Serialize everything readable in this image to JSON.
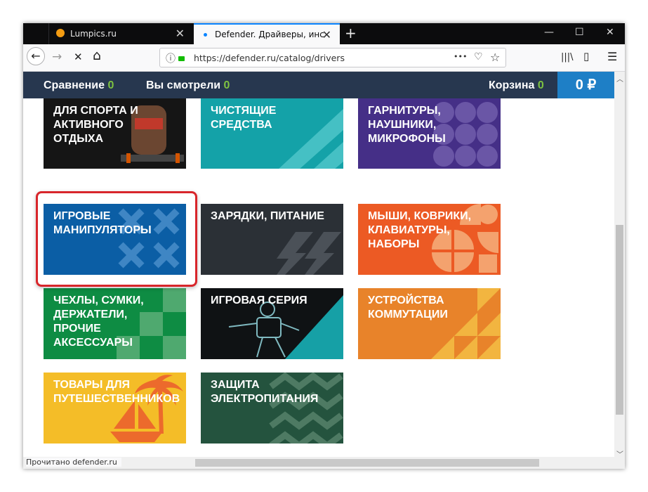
{
  "browser": {
    "tabs": [
      {
        "title": "Lumpics.ru",
        "close": "✕"
      },
      {
        "title": "Defender. Драйверы, инструкц",
        "close": "✕"
      }
    ],
    "new_tab": "+",
    "window_controls": {
      "minimize": "—",
      "maximize": "☐",
      "close": "✕"
    },
    "nav": {
      "back": "←",
      "forward": "→",
      "stop": "✕",
      "home": "⌂"
    },
    "url": "https://defender.ru/catalog/drivers",
    "url_icons": {
      "info": "ⓘ",
      "lock": "🔒",
      "more": "•••",
      "pocket": "♡",
      "bookmark": "☆"
    },
    "toolbar_icons": {
      "library": "|||\\",
      "sidebar": "▯",
      "menu": "☰"
    },
    "status_text": "Прочитано defender.ru",
    "scroll_arrows": {
      "up": "︿",
      "down": "﹀"
    }
  },
  "site_header": {
    "compare_label": "Сравнение",
    "compare_count": "0",
    "viewed_label": "Вы смотрели",
    "viewed_count": "0",
    "cart_label": "Корзина",
    "cart_count": "0",
    "cart_total": "0 ₽"
  },
  "categories": [
    {
      "label": "ДЛЯ СПОРТА И\nАКТИВНОГО\nОТДЫХА",
      "color": "#1a1a1a",
      "icon": "athlete-image"
    },
    {
      "label": "ЧИСТЯЩИЕ\nСРЕДСТВА",
      "color": "#14a2a8",
      "icon": "stripes-icon"
    },
    {
      "label": "ГАРНИТУРЫ,\nНАУШНИКИ,\nМИКРОФОНЫ",
      "color": "#452f87",
      "icon": "circles-icon"
    },
    {
      "label": "ИГРОВЫЕ\nМАНИПУЛЯТОРЫ",
      "color": "#0b5ea5",
      "icon": "crosses-icon"
    },
    {
      "label": "ЗАРЯДКИ, ПИТАНИЕ",
      "color": "#2b3036",
      "icon": "lightning-icon"
    },
    {
      "label": "МЫШИ, КОВРИКИ,\nКЛАВИАТУРЫ,\nНАБОРЫ",
      "color": "#ec5a24",
      "icon": "quarter-circles-icon"
    },
    {
      "label": "ЧЕХЛЫ, СУМКИ,\nДЕРЖАТЕЛИ,\nПРОЧИЕ\nАКСЕССУАРЫ",
      "color": "#0e8c43",
      "icon": "checker-icon"
    },
    {
      "label": "ИГРОВАЯ СЕРИЯ",
      "color": "#0f1214",
      "icon": "robot-image"
    },
    {
      "label": "УСТРОЙСТВА\nКОММУТАЦИИ",
      "color": "#e8832a",
      "icon": "triangles-icon"
    },
    {
      "label": "ТОВАРЫ ДЛЯ\nПУТЕШЕСТВЕННИКОВ",
      "color": "#f4bd28",
      "icon": "palm-boat-icon"
    },
    {
      "label": "ЗАЩИТА\nЭЛЕКТРОПИТАНИЯ",
      "color": "#24533e",
      "icon": "zigzag-icon"
    }
  ]
}
